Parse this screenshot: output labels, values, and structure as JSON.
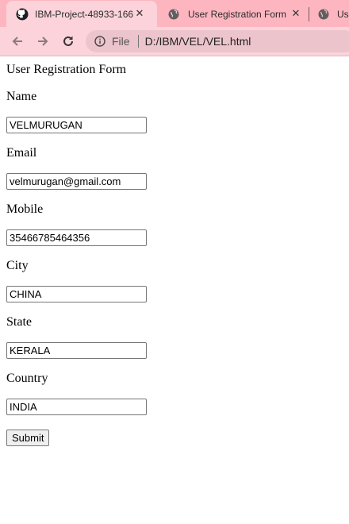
{
  "browser": {
    "tabs": [
      {
        "title": "IBM-Project-48933-166",
        "icon": "github-icon",
        "active": true
      },
      {
        "title": "User Registration Form",
        "icon": "globe-icon",
        "active": false
      },
      {
        "title": "Use",
        "icon": "globe-icon",
        "active": false
      }
    ],
    "address_bar": {
      "scheme_label": "File",
      "url": "D:/IBM/VEL/VEL.html"
    }
  },
  "form": {
    "heading": "User Registration Form",
    "fields": [
      {
        "label": "Name",
        "value": "VELMURUGAN"
      },
      {
        "label": "Email",
        "value": "velmurugan@gmail.com"
      },
      {
        "label": "Mobile",
        "value": "35466785464356"
      },
      {
        "label": "City",
        "value": "CHINA"
      },
      {
        "label": "State",
        "value": "KERALA"
      },
      {
        "label": "Country",
        "value": "INDIA"
      }
    ],
    "submit_label": "Submit"
  }
}
